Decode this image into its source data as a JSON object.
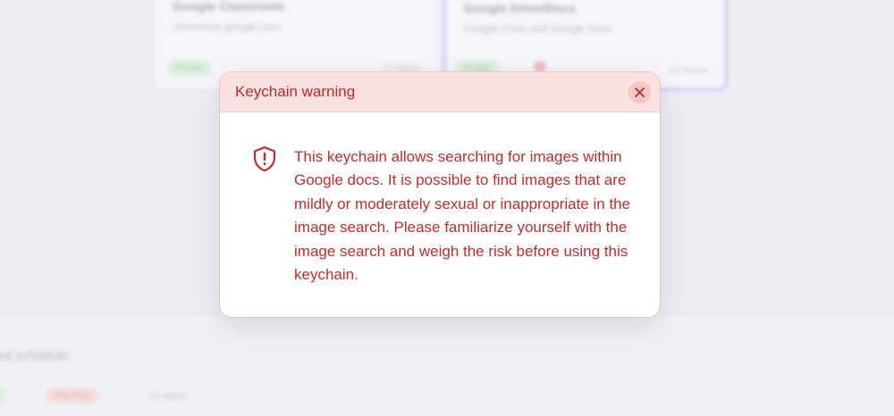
{
  "background": {
    "card_classroom": {
      "title": "Google Classroom",
      "subtitle": "classroom.google.com",
      "status_pill": "Public",
      "meta": "12 hours"
    },
    "card_drive": {
      "title": "Google Drive/Docs",
      "subtitle": "Google Drive and Google Docs",
      "status_pill": "Public",
      "meta": "12 hours"
    },
    "bottom_section": {
      "heading": "ed schedule",
      "status_pill": "ic",
      "warning_pill": "Warning",
      "meta": "12 hours"
    }
  },
  "modal": {
    "title": "Keychain warning",
    "close_icon": "close-icon",
    "warning_icon": "shield-alert-icon",
    "body": "This keychain allows searching for images within Google docs. It is possible to find images that are mildly or moderately sexual or inappropriate in the image search. Please familiarize yourself with the image search and weigh the risk before using this keychain."
  },
  "colors": {
    "accent_red": "#c62b2b",
    "header_bg": "#f9e1e1",
    "close_bg": "#f3c7c7",
    "selected_card_border": "#c7bff5"
  }
}
